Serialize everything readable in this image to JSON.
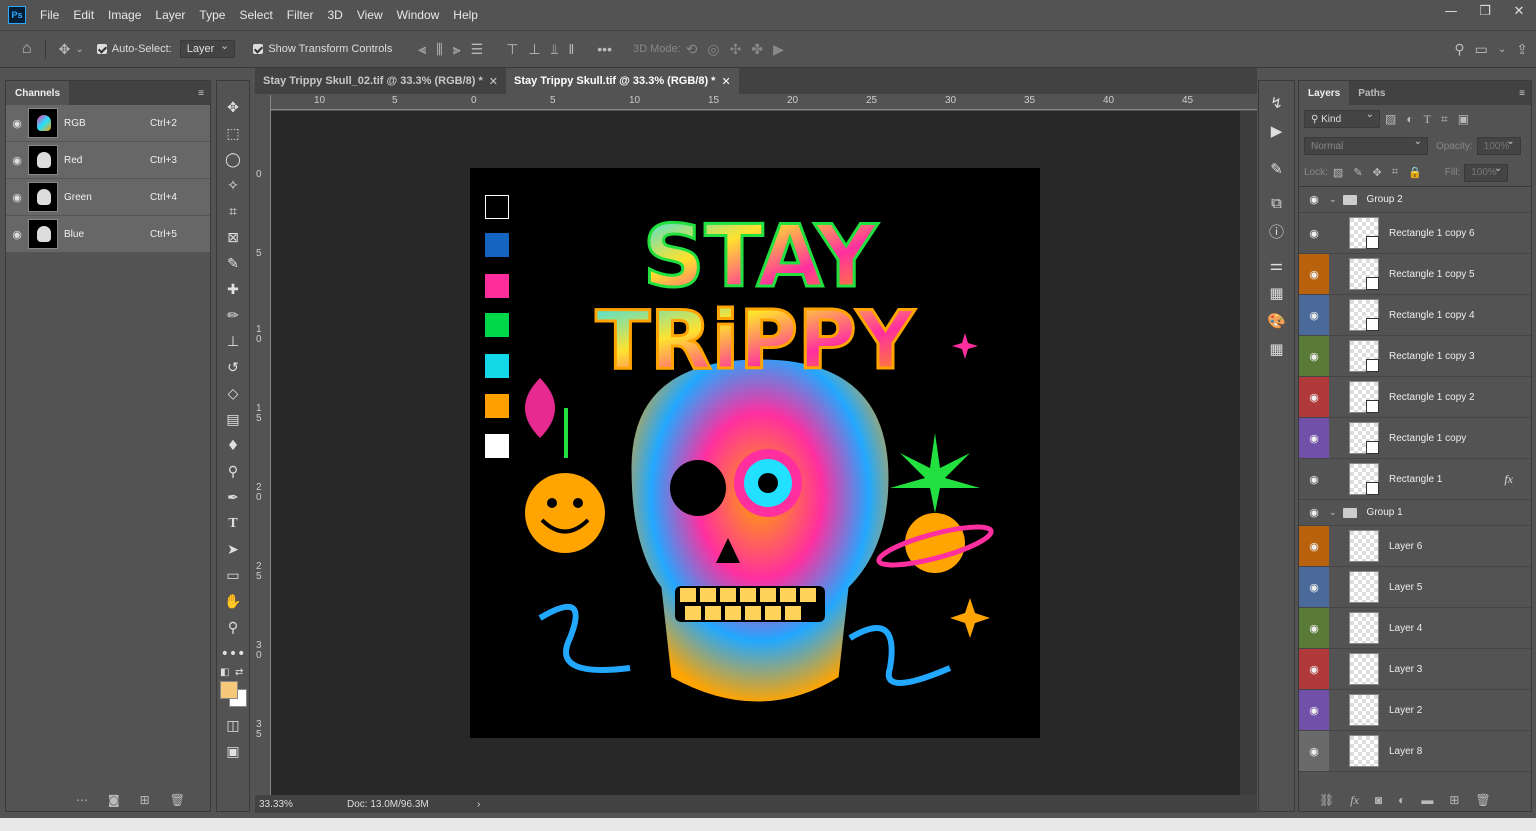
{
  "menu": {
    "items": [
      "File",
      "Edit",
      "Image",
      "Layer",
      "Type",
      "Select",
      "Filter",
      "3D",
      "View",
      "Window",
      "Help"
    ],
    "logo": "Ps"
  },
  "options": {
    "auto_select_label": "Auto-Select:",
    "auto_select_value": "Layer",
    "show_transform": "Show Transform Controls",
    "mode3d": "3D Mode:"
  },
  "channels": {
    "tab": "Channels",
    "rows": [
      {
        "name": "RGB",
        "key": "Ctrl+2"
      },
      {
        "name": "Red",
        "key": "Ctrl+3"
      },
      {
        "name": "Green",
        "key": "Ctrl+4"
      },
      {
        "name": "Blue",
        "key": "Ctrl+5"
      }
    ]
  },
  "tabs": [
    {
      "label": "Stay Trippy Skull_02.tif @ 33.3% (RGB/8) *",
      "active": false
    },
    {
      "label": "Stay Trippy Skull.tif @ 33.3% (RGB/8) *",
      "active": true
    }
  ],
  "ruler_h": [
    "10",
    "5",
    "0",
    "5",
    "10",
    "15",
    "20",
    "25",
    "30",
    "35",
    "40",
    "45"
  ],
  "ruler_v": [
    "0",
    "5",
    "1 0",
    "1 5",
    "2 0",
    "2 5",
    "3 0",
    "3 5"
  ],
  "status": {
    "zoom": "33.33%",
    "doc": "Doc: 13.0M/96.3M"
  },
  "artwork": {
    "line1": "STAY",
    "line2": "TRiPPY",
    "swatches": [
      "#000000",
      "#1565c0",
      "#ff2d9b",
      "#00d84a",
      "#12d8e8",
      "#ffa000",
      "#ffffff"
    ]
  },
  "layers": {
    "tabs": [
      "Layers",
      "Paths"
    ],
    "kind": "Kind",
    "blend": "Normal",
    "opacity_label": "Opacity:",
    "opacity": "100%",
    "lock_label": "Lock:",
    "fill_label": "Fill:",
    "fill": "100%",
    "rows": [
      {
        "type": "group",
        "name": "Group 2"
      },
      {
        "type": "layer",
        "name": "Rectangle 1 copy 6",
        "color": "#535353",
        "smart": true
      },
      {
        "type": "layer",
        "name": "Rectangle 1 copy 5",
        "color": "#b8620e",
        "smart": true
      },
      {
        "type": "layer",
        "name": "Rectangle 1 copy 4",
        "color": "#4a6a9a",
        "smart": true
      },
      {
        "type": "layer",
        "name": "Rectangle 1 copy 3",
        "color": "#5a7a38",
        "smart": true
      },
      {
        "type": "layer",
        "name": "Rectangle 1 copy 2",
        "color": "#b03a3a",
        "smart": true
      },
      {
        "type": "layer",
        "name": "Rectangle 1 copy",
        "color": "#7050a8",
        "smart": true
      },
      {
        "type": "layer",
        "name": "Rectangle 1",
        "color": "#535353",
        "smart": true,
        "fx": "fx"
      },
      {
        "type": "group",
        "name": "Group 1"
      },
      {
        "type": "layer",
        "name": "Layer 6",
        "color": "#b8620e"
      },
      {
        "type": "layer",
        "name": "Layer 5",
        "color": "#4a6a9a"
      },
      {
        "type": "layer",
        "name": "Layer 4",
        "color": "#5a7a38"
      },
      {
        "type": "layer",
        "name": "Layer 3",
        "color": "#b03a3a"
      },
      {
        "type": "layer",
        "name": "Layer 2",
        "color": "#7050a8"
      },
      {
        "type": "layer",
        "name": "Layer 8",
        "color": "#6a6a6a"
      }
    ]
  }
}
